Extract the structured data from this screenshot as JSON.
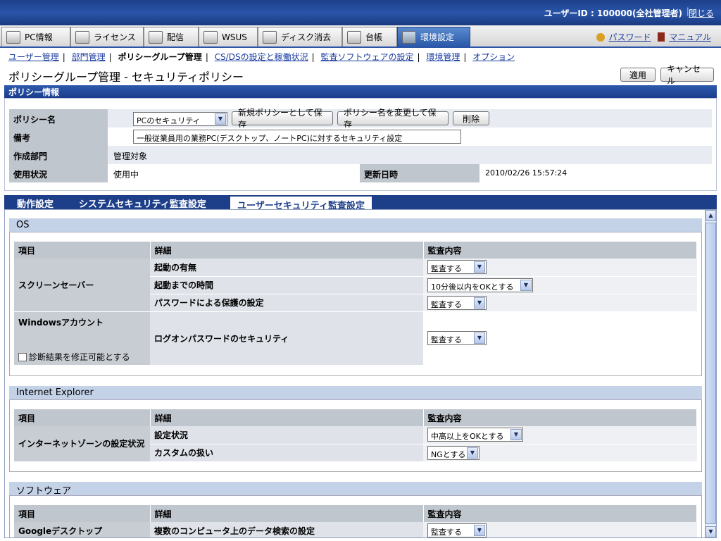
{
  "header": {
    "user_label": "ユーザーID : 100000(全社管理者)",
    "separator": "|",
    "close_label": "閉じる"
  },
  "main_tabs": [
    {
      "label": "PC情報",
      "icon": "pc-icon"
    },
    {
      "label": "ライセンス",
      "icon": "license-icon"
    },
    {
      "label": "配信",
      "icon": "delivery-icon"
    },
    {
      "label": "WSUS",
      "icon": "wsus-icon"
    },
    {
      "label": "ディスク消去",
      "icon": "disk-erase-icon"
    },
    {
      "label": "台帳",
      "icon": "ledger-icon"
    },
    {
      "label": "環境設定",
      "icon": "settings-icon"
    }
  ],
  "top_links": {
    "password": "パスワード",
    "manual": "マニュアル"
  },
  "subnav": {
    "items": [
      "ユーザー管理",
      "部門管理",
      "ポリシーグループ管理",
      "CS/DSの設定と稼働状況",
      "監査ソフトウェアの設定",
      "環境管理",
      "オプション"
    ],
    "sep": "|"
  },
  "page": {
    "title": "ポリシーグループ管理 - セキュリティポリシー",
    "apply": "適用",
    "cancel": "キャンセル"
  },
  "policy_info": {
    "section_title": "ポリシー情報",
    "name_label": "ポリシー名",
    "name_value": "PCのセキュリティ",
    "save_new": "新規ポリシーとして保存",
    "save_rename": "ポリシー名を変更して保存",
    "delete": "削除",
    "note_label": "備考",
    "note_value": "一般従業員用の業務PC(デスクトップ、ノートPC)に対するセキュリティ設定",
    "dept_label": "作成部門",
    "dept_value": "管理対象",
    "status_label": "使用状況",
    "status_value": "使用中",
    "updated_label": "更新日時",
    "updated_value": "2010/02/26 15:57:24"
  },
  "policy_tabs": [
    "動作設定",
    "システムセキュリティ監査設定",
    "ユーザーセキュリティ監査設定"
  ],
  "columns": {
    "item": "項目",
    "detail": "詳細",
    "audit": "監査内容"
  },
  "os": {
    "title": "OS",
    "screensaver": "スクリーンセーバー",
    "ss_rows": [
      {
        "detail": "起動の有無",
        "value": "監査する"
      },
      {
        "detail": "起動までの時間",
        "value": "10分後以内をOKとする"
      },
      {
        "detail": "パスワードによる保護の設定",
        "value": "監査する"
      }
    ],
    "win_account": "Windowsアカウント",
    "win_checkbox": "診断結果を修正可能とする",
    "win_detail": "ログオンパスワードのセキュリティ",
    "win_value": "監査する"
  },
  "ie": {
    "title": "Internet Explorer",
    "item": "インターネットゾーンの設定状況",
    "rows": [
      {
        "detail": "設定状況",
        "value": "中高以上をOKとする"
      },
      {
        "detail": "カスタムの扱い",
        "value": "NGとする"
      }
    ]
  },
  "software": {
    "title": "ソフトウェア",
    "item": "Googleデスクトップ",
    "detail": "複数のコンピュータ上のデータ検索の設定",
    "value": "監査する"
  }
}
